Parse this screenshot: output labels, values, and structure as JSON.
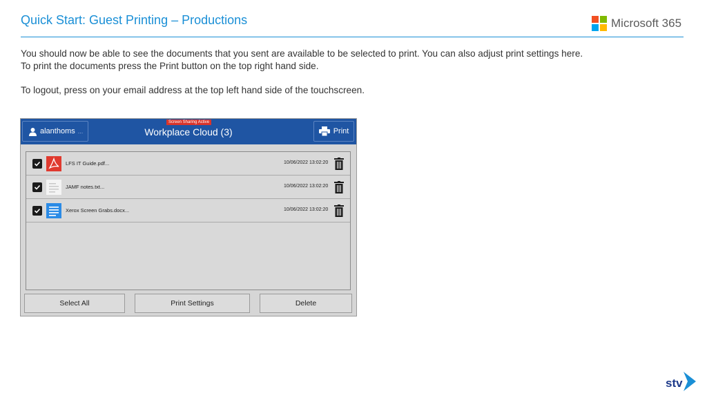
{
  "slide": {
    "title": "Quick Start: Guest Printing – Productions",
    "brand": "Microsoft 365",
    "brand_colors": [
      "#f25022",
      "#7fba00",
      "#00a4ef",
      "#ffb900"
    ],
    "paragraph1_line1": "You should now be able to see the documents that you sent are available to be selected to print. You can also adjust print settings here.",
    "paragraph1_line2": "To print the documents press the Print button on the top right hand side.",
    "paragraph2": "To logout, press on your email address at the top left hand side of the touchscreen.",
    "footer_logo": "stv-logo"
  },
  "device": {
    "user_label": "alanthoms",
    "user_ellipsis": "...",
    "screen_sharing_badge": "Screen Sharing Active",
    "app_title": "Workplace Cloud (3)",
    "print_label": "Print",
    "documents": [
      {
        "name": "LFS IT Guide.pdf...",
        "timestamp": "10/06/2022 13:02:20",
        "icon": "pdf-icon",
        "checked": true
      },
      {
        "name": "JAMF notes.txt...",
        "timestamp": "10/06/2022 13:02:20",
        "icon": "text-file-icon",
        "checked": true
      },
      {
        "name": "Xerox Screen Grabs.docx...",
        "timestamp": "10/06/2022 13:02:20",
        "icon": "word-doc-icon",
        "checked": true
      }
    ],
    "buttons": {
      "select_all": "Select All",
      "print_settings": "Print Settings",
      "delete": "Delete"
    },
    "colors": {
      "topbar": "#1f55a3",
      "accent": "#1a8fd6",
      "badge": "#d9342b"
    }
  }
}
